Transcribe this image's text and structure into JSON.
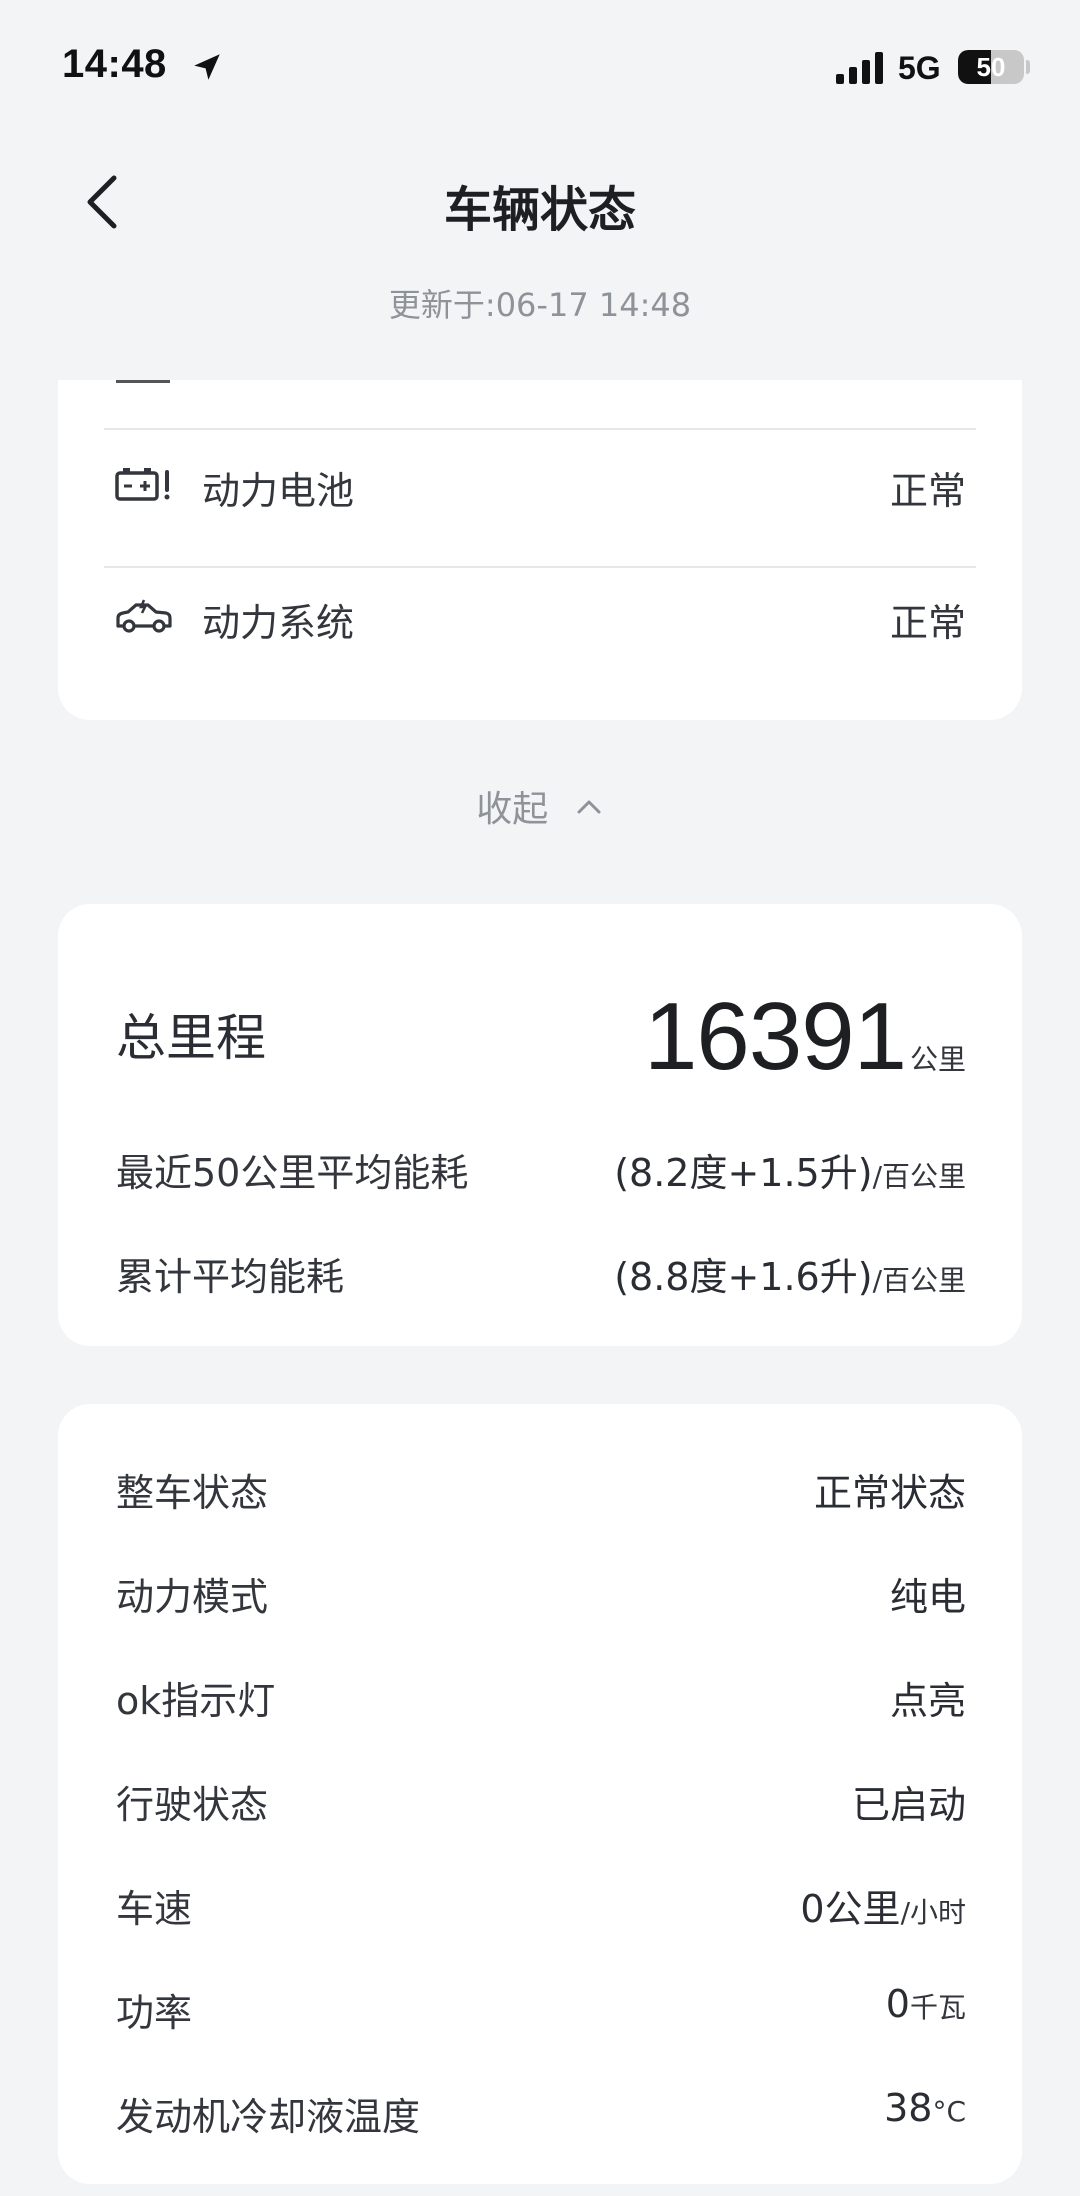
{
  "status_bar": {
    "time": "14:48",
    "network": "5G",
    "battery": "50",
    "battery_level": 0.5
  },
  "nav": {
    "title": "车辆状态",
    "updated": "更新于:06-17 14:48"
  },
  "systems": [
    {
      "label": "动力电池",
      "value": "正常",
      "icon": "battery-warning-icon"
    },
    {
      "label": "动力系统",
      "value": "正常",
      "icon": "car-powertrain-icon"
    }
  ],
  "collapse": {
    "label": "收起"
  },
  "mileage": {
    "label": "总里程",
    "value": "16391",
    "unit": "公里",
    "consumption": [
      {
        "label": "最近50公里平均能耗",
        "value": "(8.2度+1.5升)",
        "unit": "/百公里"
      },
      {
        "label": "累计平均能耗",
        "value": "(8.8度+1.6升)",
        "unit": "/百公里"
      }
    ]
  },
  "vehicle_status": [
    {
      "label": "整车状态",
      "value": "正常状态",
      "unit": ""
    },
    {
      "label": "动力模式",
      "value": "纯电",
      "unit": ""
    },
    {
      "label": "ok指示灯",
      "value": "点亮",
      "unit": ""
    },
    {
      "label": "行驶状态",
      "value": "已启动",
      "unit": ""
    },
    {
      "label": "车速",
      "value": "0公里",
      "unit": "/小时"
    },
    {
      "label": "功率",
      "value": "0",
      "unit": "千瓦"
    },
    {
      "label": "发动机冷却液温度",
      "value": "38",
      "unit": "°C"
    }
  ]
}
